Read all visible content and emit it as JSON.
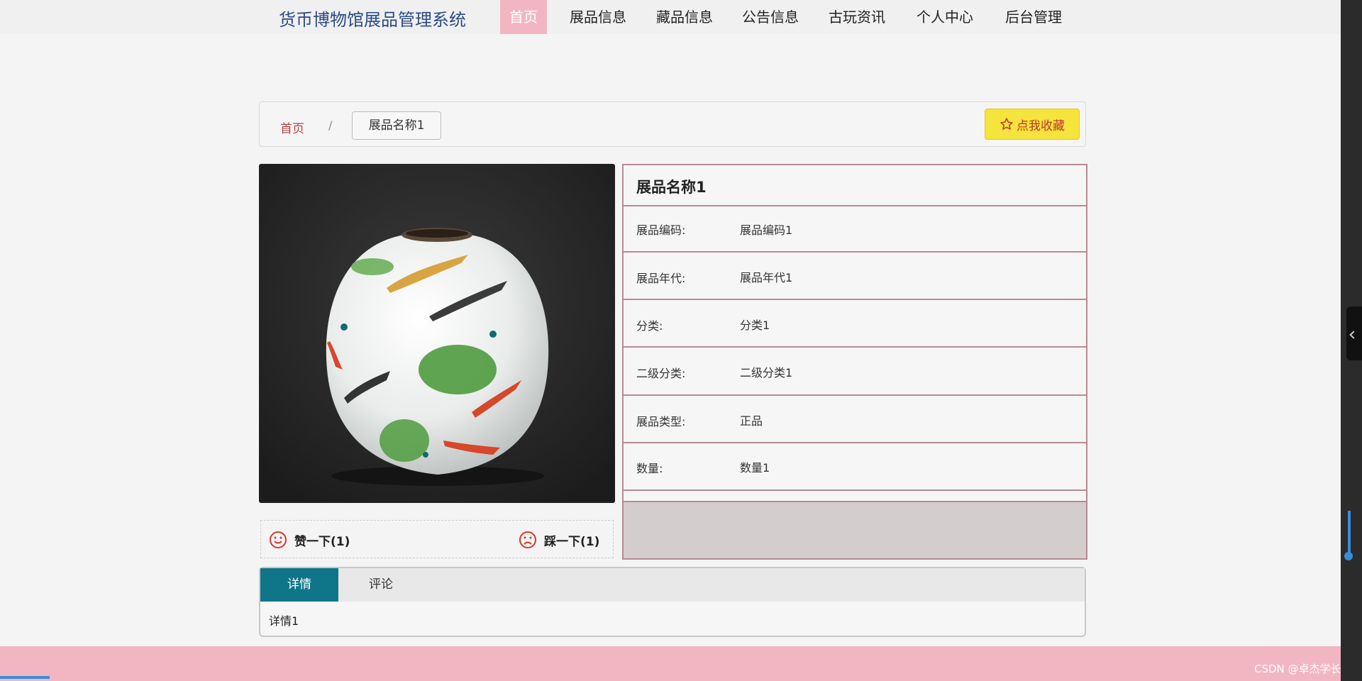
{
  "site": {
    "title": "货币博物馆展品管理系统"
  },
  "nav": {
    "items": [
      {
        "label": "首页",
        "active": true
      },
      {
        "label": "展品信息"
      },
      {
        "label": "藏品信息"
      },
      {
        "label": "公告信息"
      },
      {
        "label": "古玩资讯"
      },
      {
        "label": "个人中心"
      },
      {
        "label": "后台管理"
      }
    ]
  },
  "breadcrumb": {
    "home": "首页",
    "separator": "/",
    "current": "展品名称1"
  },
  "favorite": {
    "label": "点我收藏",
    "icon": "star-icon"
  },
  "product": {
    "name": "展品名称1",
    "image": "porcelain-vase-with-fish",
    "fields": [
      {
        "label": "展品编码:",
        "value": "展品编码1"
      },
      {
        "label": "展品年代:",
        "value": "展品年代1"
      },
      {
        "label": "分类:",
        "value": "分类1"
      },
      {
        "label": "二级分类:",
        "value": "二级分类1"
      },
      {
        "label": "展品类型:",
        "value": "正品"
      },
      {
        "label": "数量:",
        "value": "数量1"
      }
    ]
  },
  "votes": {
    "like_label": "赞一下(1)",
    "dislike_label": "踩一下(1)"
  },
  "tabs": {
    "items": [
      {
        "label": "详情",
        "active": true
      },
      {
        "label": "评论"
      }
    ],
    "content": "详情1"
  },
  "footer": {
    "watermark": "CSDN @卓杰学长"
  },
  "colors": {
    "accent_pink": "#f2b6c2",
    "tab_active": "#0f7689",
    "favorite_bg": "#f5e33e",
    "table_border": "#b98a93",
    "title_blue": "#2c4a86",
    "icon_red": "#d9332b"
  }
}
